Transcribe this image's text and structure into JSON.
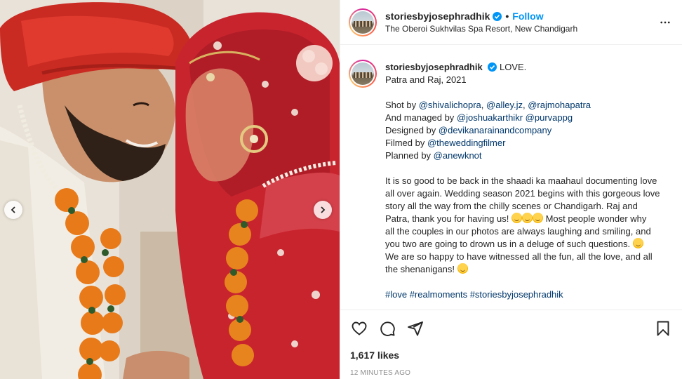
{
  "post": {
    "username": "storiesbyjosephradhik",
    "separator": "•",
    "follow_label": "Follow",
    "location": "The Oberoi Sukhvilas Spa Resort, New Chandigarh",
    "more_label": "•••"
  },
  "caption": {
    "username": "storiesbyjosephradhik",
    "first_line_text": "LOVE.",
    "line2": "Patra and Raj, 2021",
    "shot_by_prefix": "Shot by ",
    "shot_by_tags": [
      "@shivalichopra",
      "@alley.jz",
      "@rajmohapatra"
    ],
    "managed_prefix": "And managed by ",
    "managed_tags": [
      "@joshuakarthikr",
      "@purvappg"
    ],
    "designed_prefix": "Designed by ",
    "designed_tag": "@devikanarainandcompany",
    "filmed_prefix": "Filmed by ",
    "filmed_tag": "@theweddingfilmer",
    "planned_prefix": "Planned by ",
    "planned_tag": "@anewknot",
    "para_lines": [
      "It is so good to be back in the shaadi ka maahaul documenting love",
      "all over again. Wedding season 2021 begins with this gorgeous love",
      "story all the way from the chilly scenes or Chandigarh. Raj and",
      "Patra, thank you for having us!",
      "Most people wonder why",
      "all the couples in our photos are always laughing and smiling, and",
      "you two are going to drown us in a deluge of such questions.",
      "We are so happy to have witnessed all the fun, all the love, and all",
      "the shenanigans!"
    ],
    "hashtags": [
      "#love",
      "#realmoments",
      "#storiesbyjosephradhik"
    ]
  },
  "engagement": {
    "likes": "1,617 likes",
    "timestamp": "12 MINUTES AGO"
  },
  "icons": {
    "verified": "verified-badge-icon",
    "like": "heart-icon",
    "comment": "comment-icon",
    "share": "paper-plane-icon",
    "save": "bookmark-icon",
    "prev": "chevron-left-icon",
    "next": "chevron-right-icon"
  },
  "colors": {
    "accent": "#0095f6",
    "link": "#00376b",
    "text": "#262626",
    "muted": "#8e8e8e",
    "border": "#efefef"
  }
}
